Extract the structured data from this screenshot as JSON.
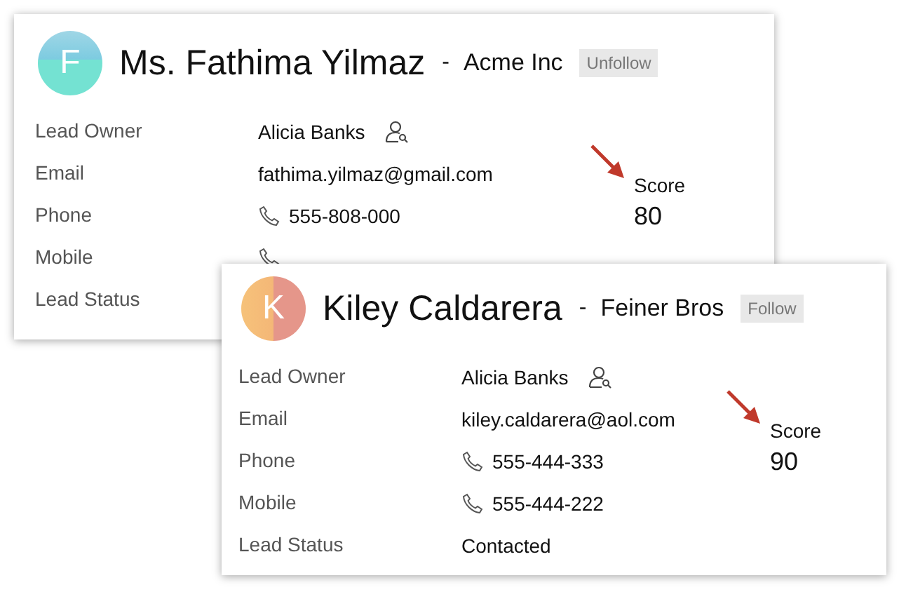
{
  "cards": [
    {
      "avatar": {
        "letter": "F",
        "kind": "teal"
      },
      "name": "Ms. Fathima Yilmaz",
      "separator": "-",
      "company": "Acme Inc",
      "follow_button": "Unfollow",
      "fields": [
        {
          "label": "Lead Owner",
          "value": "Alicia Banks",
          "kind": "owner"
        },
        {
          "label": "Email",
          "value": "fathima.yilmaz@gmail.com",
          "kind": "text"
        },
        {
          "label": "Phone",
          "value": "555-808-000",
          "kind": "phone"
        },
        {
          "label": "Mobile",
          "kind": "phone"
        },
        {
          "label": "Lead Status",
          "kind": "text"
        }
      ],
      "score": {
        "label": "Score",
        "value": "80"
      }
    },
    {
      "avatar": {
        "letter": "K",
        "kind": "peach"
      },
      "name": "Kiley Caldarera",
      "separator": "-",
      "company": "Feiner Bros",
      "follow_button": "Follow",
      "fields": [
        {
          "label": "Lead Owner",
          "value": "Alicia Banks",
          "kind": "owner"
        },
        {
          "label": "Email",
          "value": "kiley.caldarera@aol.com",
          "kind": "text"
        },
        {
          "label": "Phone",
          "value": "555-444-333",
          "kind": "phone"
        },
        {
          "label": "Mobile",
          "value": "555-444-222",
          "kind": "phone"
        },
        {
          "label": "Lead Status",
          "value": "Contacted",
          "kind": "text"
        }
      ],
      "score": {
        "label": "Score",
        "value": "90"
      }
    }
  ]
}
